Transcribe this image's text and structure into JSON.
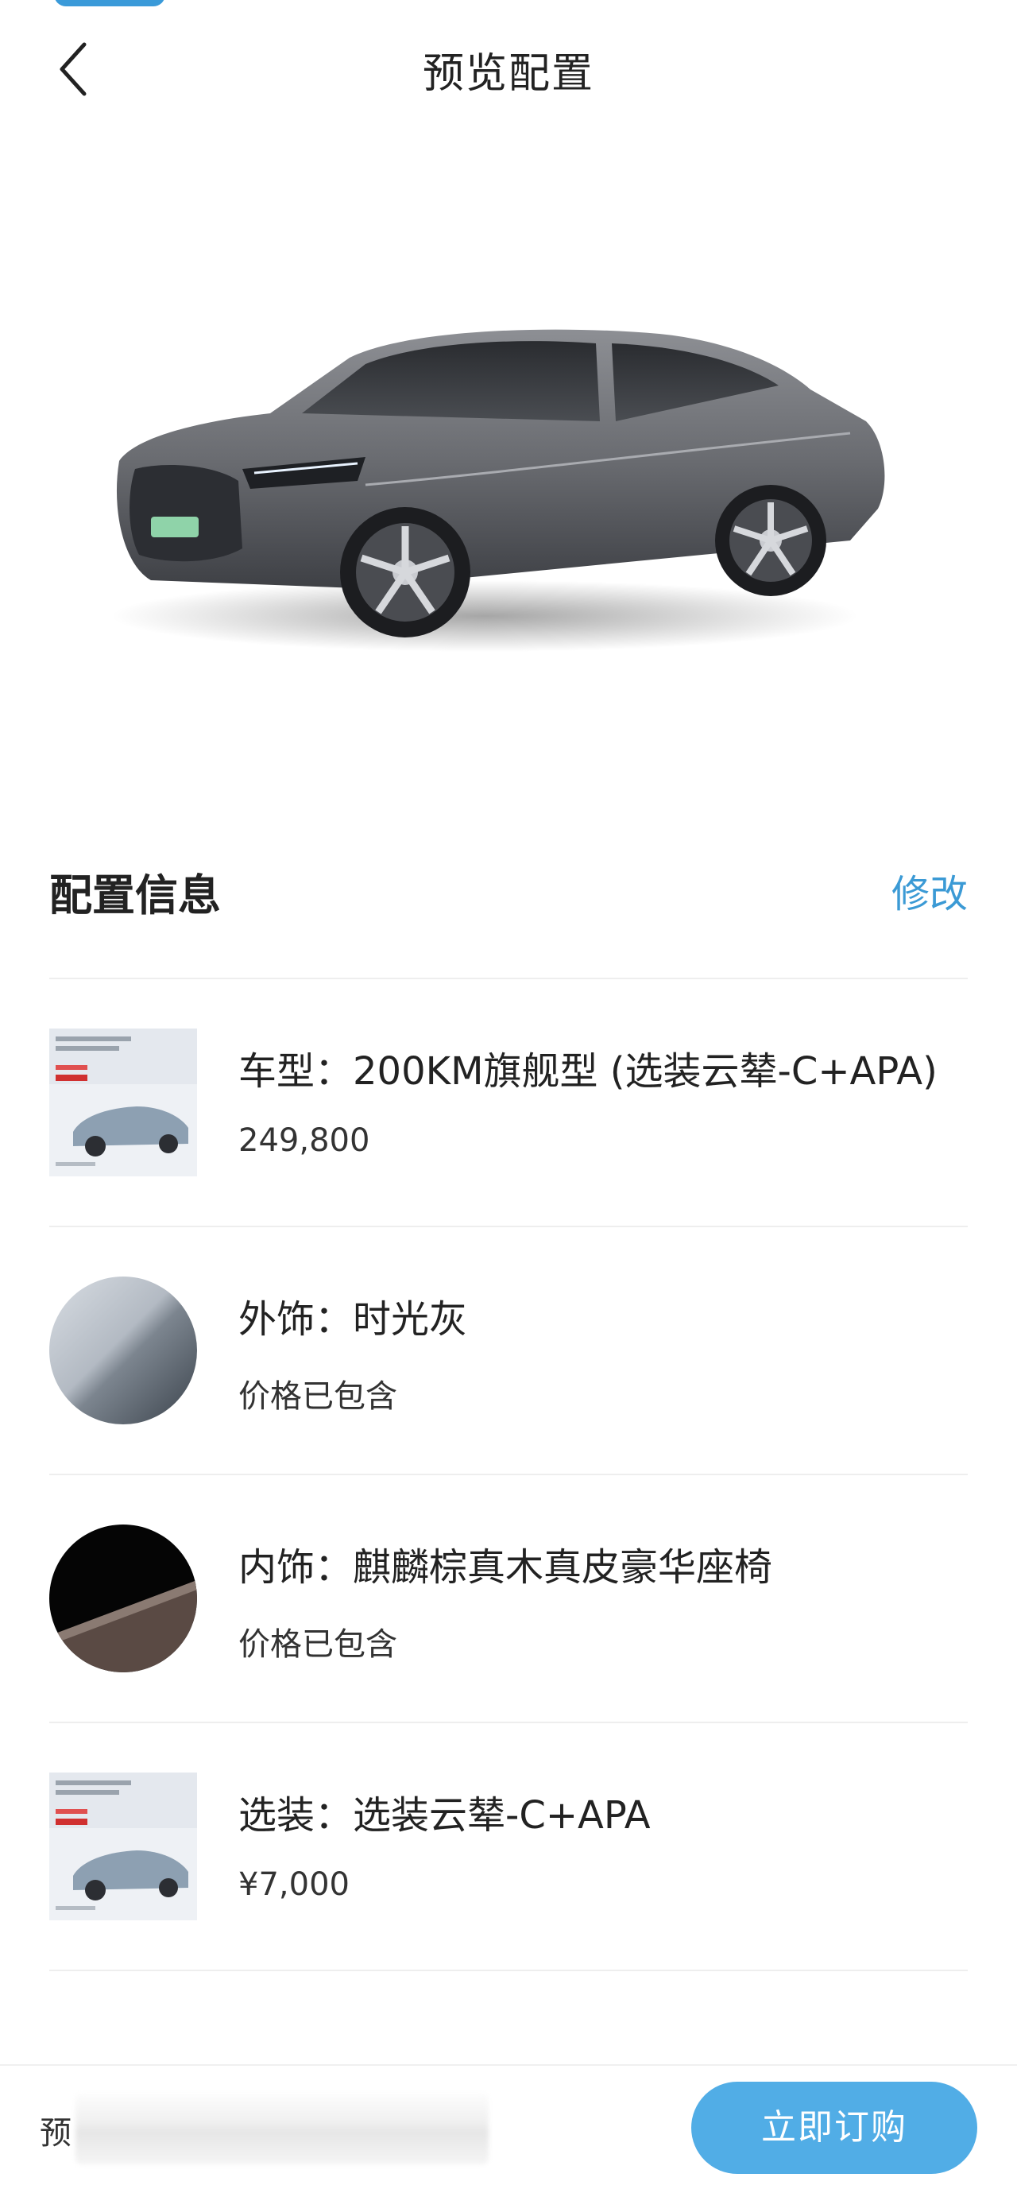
{
  "header": {
    "title": "预览配置",
    "back_icon": "chevron-left-icon"
  },
  "section": {
    "title": "配置信息",
    "edit_label": "修改"
  },
  "items": [
    {
      "title": "车型：200KM旗舰型 (选装云辇-C+APA)",
      "sub": "249,800",
      "thumb": "car-promo-thumbnail"
    },
    {
      "title": "外饰：时光灰",
      "sub": "价格已包含",
      "thumb": "exterior-color-swatch"
    },
    {
      "title": "内饰：麒麟棕真木真皮豪华座椅",
      "sub": "价格已包含",
      "thumb": "interior-color-swatch"
    },
    {
      "title": "选装：选装云辇-C+APA",
      "sub": "¥7,000",
      "thumb": "option-promo-thumbnail"
    }
  ],
  "bottom_bar": {
    "price_label": "预",
    "order_button": "立即订购"
  },
  "colors": {
    "accent": "#51ade6",
    "link": "#3b9ad5",
    "car_body": "#5f6166"
  }
}
